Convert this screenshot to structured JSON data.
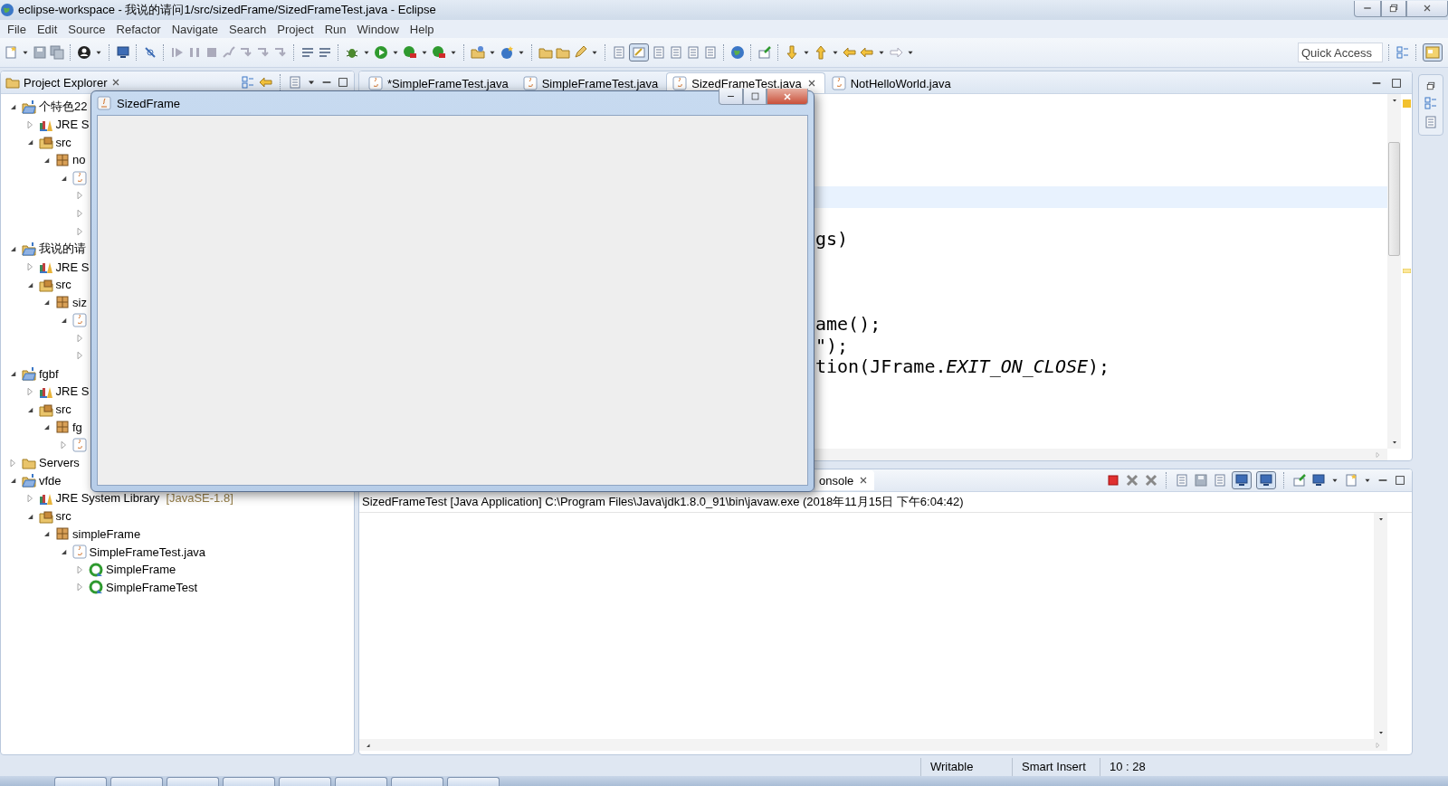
{
  "window": {
    "title": "eclipse-workspace - 我说的请问1/src/sizedFrame/SizedFrameTest.java - Eclipse"
  },
  "menu": [
    "File",
    "Edit",
    "Source",
    "Refactor",
    "Navigate",
    "Search",
    "Project",
    "Run",
    "Window",
    "Help"
  ],
  "toolbar": {
    "quick_access": {
      "placeholder": "Quick Access"
    }
  },
  "project_explorer": {
    "title": "Project Explorer",
    "tree": [
      {
        "label": "个特色22",
        "kind": "project",
        "expanded": true,
        "children": [
          {
            "label": "JRE S",
            "kind": "library",
            "expanded": false
          },
          {
            "label": "src",
            "kind": "source-folder",
            "expanded": true,
            "children": [
              {
                "label": "no",
                "kind": "package",
                "expanded": true,
                "children": [
                  {
                    "kind": "java-file",
                    "expanded": true,
                    "children": [
                      {
                        "kind": "covered",
                        "expanded": false
                      },
                      {
                        "kind": "covered",
                        "expanded": false
                      },
                      {
                        "kind": "covered",
                        "expanded": false
                      }
                    ]
                  }
                ]
              }
            ]
          }
        ]
      },
      {
        "label": "我说的请",
        "kind": "project",
        "expanded": true,
        "children": [
          {
            "label": "JRE S",
            "kind": "library",
            "expanded": false
          },
          {
            "label": "src",
            "kind": "source-folder",
            "expanded": true,
            "children": [
              {
                "label": "siz",
                "kind": "package",
                "expanded": true,
                "children": [
                  {
                    "kind": "java-file",
                    "expanded": true,
                    "children": [
                      {
                        "kind": "covered",
                        "expanded": false
                      },
                      {
                        "kind": "covered",
                        "expanded": false
                      }
                    ]
                  }
                ]
              }
            ]
          }
        ]
      },
      {
        "label": "fgbf",
        "kind": "project",
        "expanded": true,
        "children": [
          {
            "label": "JRE S",
            "kind": "library",
            "expanded": false
          },
          {
            "label": "src",
            "kind": "source-folder",
            "expanded": true,
            "children": [
              {
                "label": "fg",
                "kind": "package",
                "expanded": true,
                "children": [
                  {
                    "kind": "java-file",
                    "expanded": false
                  }
                ]
              }
            ]
          }
        ]
      },
      {
        "label": "Servers",
        "kind": "folder",
        "expanded": false
      },
      {
        "label": "vfde",
        "kind": "project",
        "expanded": true,
        "children": [
          {
            "label": "JRE System Library",
            "decoration": "[JavaSE-1.8]",
            "kind": "library",
            "expanded": false
          },
          {
            "label": "src",
            "kind": "source-folder",
            "expanded": true,
            "children": [
              {
                "label": "simpleFrame",
                "kind": "package",
                "expanded": true,
                "children": [
                  {
                    "label": "SimpleFrameTest.java",
                    "kind": "java-file",
                    "expanded": true,
                    "children": [
                      {
                        "label": "SimpleFrame",
                        "kind": "class",
                        "expanded": false
                      },
                      {
                        "label": "SimpleFrameTest",
                        "kind": "class",
                        "expanded": false
                      }
                    ]
                  }
                ]
              }
            ]
          }
        ]
      }
    ]
  },
  "editor": {
    "tabs": [
      {
        "label": "*SimpleFrameTest.java",
        "selected": false
      },
      {
        "label": "SimpleFrameTest.java",
        "selected": false
      },
      {
        "label": "SizedFrameTest.java",
        "selected": true
      },
      {
        "label": "NotHelloWorld.java",
        "selected": false
      }
    ],
    "code_lines": [
      {
        "text": "gs)"
      },
      {
        "text": "ame();"
      },
      {
        "text": "\");"
      },
      {
        "text": "tion(JFrame.*EXIT_ON_CLOSE*);"
      }
    ]
  },
  "console": {
    "tab": {
      "label": "onsole",
      "selected": true
    },
    "launch": "SizedFrameTest [Java Application] C:\\Program Files\\Java\\jdk1.8.0_91\\bin\\javaw.exe (2018年11月15日 下午6:04:42)"
  },
  "status_bar": [
    "Writable",
    "Smart Insert",
    "10 : 28"
  ],
  "frame_window": {
    "title": "SizedFrame"
  }
}
